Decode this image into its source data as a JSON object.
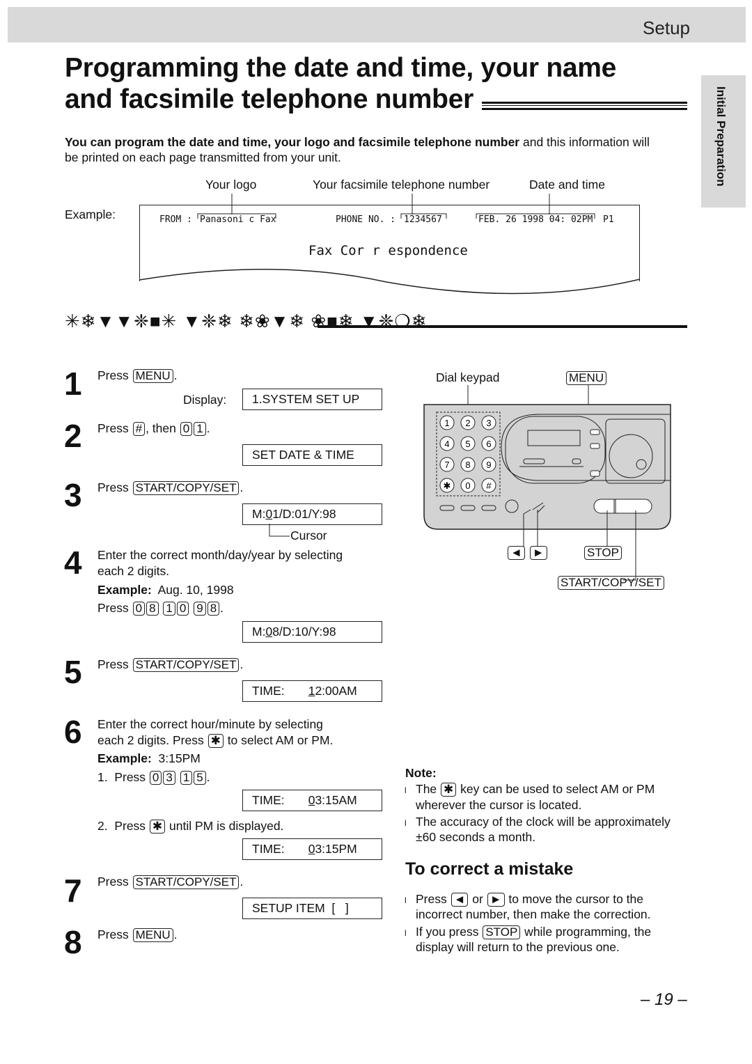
{
  "header": {
    "section": "Setup"
  },
  "title": {
    "line1": "Programming the date and time, your name",
    "line2": "and facsimile telephone number"
  },
  "side_tab": "Initial Preparation",
  "intro": {
    "bold": "You can program the date and time, your logo and facsimile telephone number",
    "rest": " and this information will",
    "line2": "be printed on each page transmitted from your unit."
  },
  "example": {
    "label": "Example:",
    "callouts": [
      "Your logo",
      "Your facsimile telephone number",
      "Date and time"
    ],
    "from_label": "FROM :",
    "logo": "Panasoni c  Fax",
    "phone_label": "PHONE  NO.  :",
    "phone": "1234567",
    "datetime": "FEB.  26  1998  04: 02PM",
    "page": "P1",
    "body": "Fax  Cor r espondence"
  },
  "dingbat_heading": "✳❄▼▼❈■✳ ▼❈❄ ❄❀▼❄ ❀■❄ ▼❈❍❄",
  "steps": {
    "s1": {
      "num": "1",
      "l1": [
        {
          "t": "Press "
        },
        {
          "k": "MENU"
        },
        {
          "t": "."
        }
      ],
      "display_label": "Display:",
      "d1": [
        {
          "t": "1.SYSTEM SET UP"
        }
      ]
    },
    "s2": {
      "num": "2",
      "l1": [
        {
          "t": "Press "
        },
        {
          "k": "#"
        },
        {
          "t": ", then "
        },
        {
          "k": "0"
        },
        {
          "k": "1"
        },
        {
          "t": "."
        }
      ],
      "d1": [
        {
          "t": "SET DATE & TIME"
        }
      ]
    },
    "s3": {
      "num": "3",
      "l1": [
        {
          "t": "Press "
        },
        {
          "k": "START/COPY/SET"
        },
        {
          "t": "."
        }
      ],
      "d1": [
        {
          "t": "M:"
        },
        {
          "u": "0"
        },
        {
          "t": "1/D:01/Y:98"
        }
      ],
      "cursor": "Cursor"
    },
    "s4": {
      "num": "4",
      "l1": [
        {
          "t": "Enter the correct month/day/year by selecting"
        }
      ],
      "l2": [
        {
          "t": "each 2 digits."
        }
      ],
      "l3": [
        {
          "b": "Example:"
        },
        {
          "t": "  Aug. 10, 1998"
        }
      ],
      "l4": [
        {
          "t": "Press "
        },
        {
          "k": "0"
        },
        {
          "k": "8"
        },
        {
          "t": " "
        },
        {
          "k": "1"
        },
        {
          "k": "0"
        },
        {
          "t": " "
        },
        {
          "k": "9"
        },
        {
          "k": "8"
        },
        {
          "t": "."
        }
      ],
      "d1": [
        {
          "t": "M:"
        },
        {
          "u": "0"
        },
        {
          "t": "8/D:10/Y:98"
        }
      ]
    },
    "s5": {
      "num": "5",
      "l1": [
        {
          "t": "Press "
        },
        {
          "k": "START/COPY/SET"
        },
        {
          "t": "."
        }
      ],
      "d1": [
        {
          "t": "TIME:       "
        },
        {
          "u": "1"
        },
        {
          "t": "2:00AM"
        }
      ]
    },
    "s6": {
      "num": "6",
      "l1": [
        {
          "t": "Enter the correct hour/minute by selecting"
        }
      ],
      "l2": [
        {
          "t": "each 2 digits. Press "
        },
        {
          "k": "✱"
        },
        {
          "t": " to select AM or PM."
        }
      ],
      "l3": [
        {
          "b": "Example:"
        },
        {
          "t": "  3:15PM"
        }
      ],
      "l4": [
        {
          "t": "1.  Press "
        },
        {
          "k": "0"
        },
        {
          "k": "3"
        },
        {
          "t": " "
        },
        {
          "k": "1"
        },
        {
          "k": "5"
        },
        {
          "t": "."
        }
      ],
      "d1": [
        {
          "t": "TIME:       "
        },
        {
          "u": "0"
        },
        {
          "t": "3:15AM"
        }
      ],
      "l5": [
        {
          "t": "2.  Press "
        },
        {
          "k": "✱"
        },
        {
          "t": " until PM is displayed."
        }
      ],
      "d2": [
        {
          "t": "TIME:       "
        },
        {
          "u": "0"
        },
        {
          "t": "3:15PM"
        }
      ]
    },
    "s7": {
      "num": "7",
      "l1": [
        {
          "t": "Press "
        },
        {
          "k": "START/COPY/SET"
        },
        {
          "t": "."
        }
      ],
      "d1": [
        {
          "t": "SETUP ITEM  [   ]"
        }
      ]
    },
    "s8": {
      "num": "8",
      "l1": [
        {
          "t": "Press "
        },
        {
          "k": "MENU"
        },
        {
          "t": "."
        }
      ]
    }
  },
  "illustration": {
    "dial_keypad": "Dial keypad",
    "menu": [
      {
        "k": "MENU"
      }
    ],
    "arrows": [
      {
        "k": "◄"
      },
      {
        "t": " "
      },
      {
        "k": "►"
      }
    ],
    "stop": [
      {
        "k": "STOP"
      }
    ],
    "start": [
      {
        "k": "START/COPY/SET"
      }
    ],
    "keypad": [
      "1",
      "2",
      "3",
      "4",
      "5",
      "6",
      "7",
      "8",
      "9",
      "✱",
      "0",
      "#"
    ]
  },
  "note": {
    "title": "Note:",
    "b1": [
      {
        "t": "The "
      },
      {
        "k": "✱"
      },
      {
        "t": " key can be used to select AM or PM"
      }
    ],
    "b1b": [
      {
        "t": "wherever the cursor is located."
      }
    ],
    "b2": [
      {
        "t": "The accuracy of the clock will be approximately"
      }
    ],
    "b2b": [
      {
        "t": "±60 seconds a month."
      }
    ]
  },
  "correct": {
    "title": "To correct a mistake",
    "b1": [
      {
        "t": "Press "
      },
      {
        "k": "◄"
      },
      {
        "t": " or "
      },
      {
        "k": "►"
      },
      {
        "t": " to move the cursor to the"
      }
    ],
    "b1b": [
      {
        "t": "incorrect number, then make the correction."
      }
    ],
    "b2": [
      {
        "t": "If you press "
      },
      {
        "k": "STOP"
      },
      {
        "t": " while programming, the"
      }
    ],
    "b2b": [
      {
        "t": "display will return to the previous one."
      }
    ]
  },
  "bullet": "l",
  "page_number": "– 19 –"
}
